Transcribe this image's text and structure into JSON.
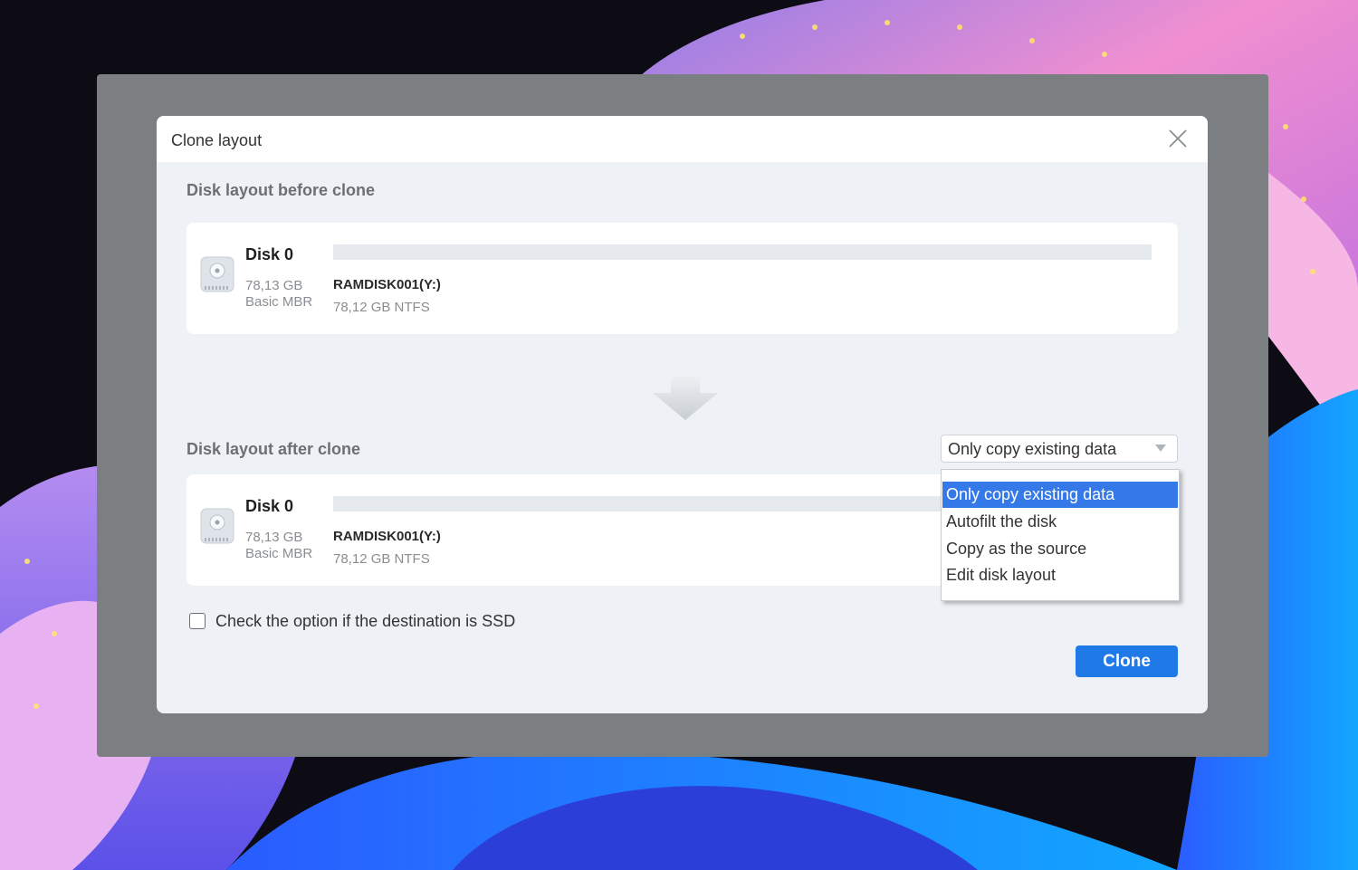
{
  "dialog": {
    "title": "Clone layout",
    "close_icon": "close-icon"
  },
  "before": {
    "section_label": "Disk layout before clone",
    "disk": {
      "icon": "hard-disk-icon",
      "name": "Disk 0",
      "size": "78,13 GB",
      "type": "Basic MBR",
      "partition_name": "RAMDISK001(Y:)",
      "partition_info": "78,12 GB NTFS"
    }
  },
  "arrow_icon": "arrow-down-icon",
  "after": {
    "section_label": "Disk layout after clone",
    "disk": {
      "icon": "hard-disk-icon",
      "name": "Disk 0",
      "size": "78,13 GB",
      "type": "Basic MBR",
      "partition_name": "RAMDISK001(Y:)",
      "partition_info": "78,12 GB NTFS"
    }
  },
  "mode_select": {
    "value": "Only copy existing data",
    "caret_icon": "caret-down-icon",
    "options": [
      {
        "label": "Only copy existing data",
        "selected": true
      },
      {
        "label": "Autofilt the disk",
        "selected": false
      },
      {
        "label": "Copy as the source",
        "selected": false
      },
      {
        "label": "Edit disk layout",
        "selected": false
      }
    ]
  },
  "ssd_option": {
    "label": "Check the option if the destination is SSD",
    "checked": false
  },
  "clone_button": {
    "label": "Clone"
  },
  "colors": {
    "accent": "#1f79e6",
    "menu_highlight": "#3579e8",
    "overlay": "#7b7f82",
    "dialog_bg": "#eef1f5"
  }
}
